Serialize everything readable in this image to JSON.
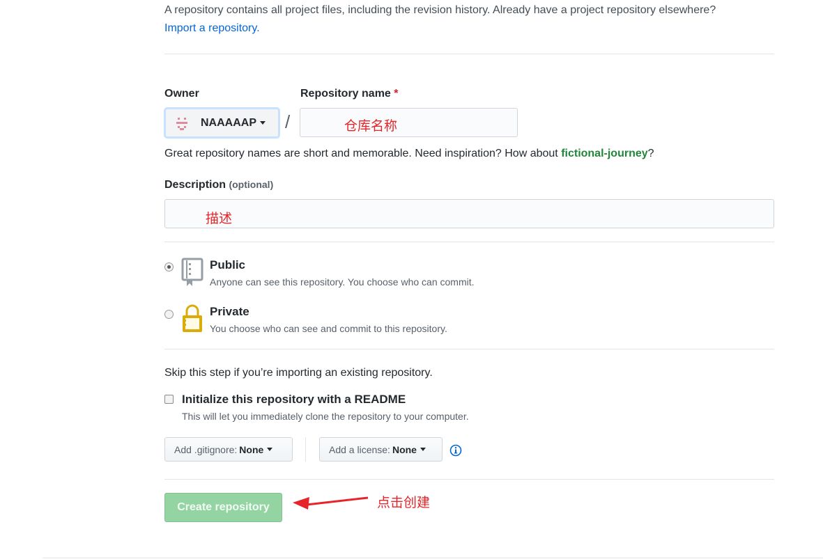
{
  "intro": {
    "text": "A repository contains all project files, including the revision history. Already have a project repository elsewhere?",
    "import_link": "Import a repository."
  },
  "owner": {
    "label": "Owner",
    "value": "NAAAAAP"
  },
  "repo_name": {
    "label": "Repository name",
    "required_mark": "*",
    "annotation": "仓库名称",
    "separator": "/"
  },
  "hint": {
    "prefix": "Great repository names are short and memorable. Need inspiration? How about ",
    "suggestion": "fictional-journey",
    "suffix": "?"
  },
  "description": {
    "label": "Description",
    "optional": "(optional)",
    "annotation": "描述"
  },
  "visibility": {
    "public_title": "Public",
    "public_note": "Anyone can see this repository. You choose who can commit.",
    "private_title": "Private",
    "private_note": "You choose who can see and commit to this repository.",
    "selected": "public"
  },
  "init": {
    "skip_text": "Skip this step if you’re importing an existing repository.",
    "readme_label": "Initialize this repository with a README",
    "readme_note": "This will let you immediately clone the repository to your computer."
  },
  "selects": {
    "gitignore_label": "Add .gitignore:",
    "gitignore_value": "None",
    "license_label": "Add a license:",
    "license_value": "None"
  },
  "create": {
    "button": "Create repository",
    "annotation": "点击创建"
  },
  "colors": {
    "link": "#0366d6",
    "annotation": "#e6252a",
    "create_button": "#94d3a2",
    "suggestion": "#22863a"
  }
}
